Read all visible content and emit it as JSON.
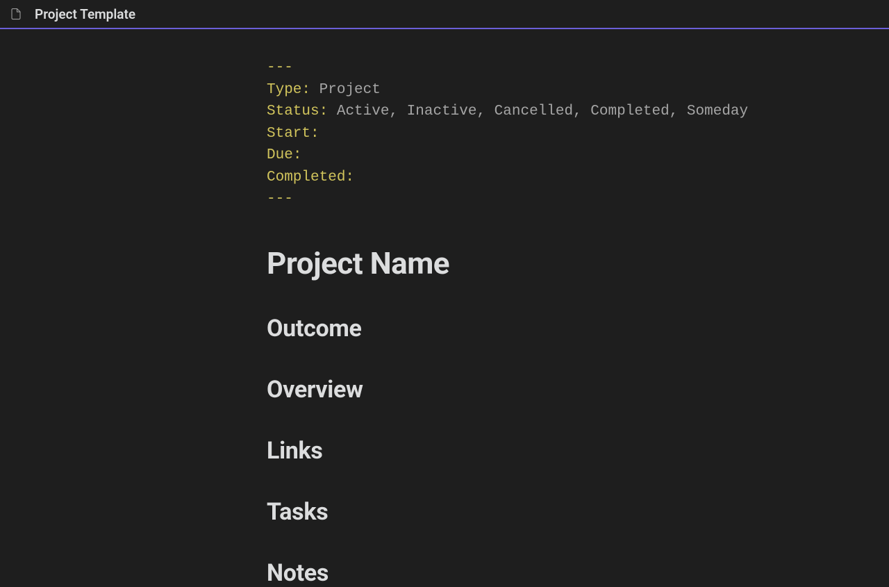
{
  "header": {
    "title": "Project Template"
  },
  "frontmatter": {
    "sep": "---",
    "type_key": "Type",
    "type_val": "Project",
    "status_key": "Status",
    "status_val": "Active, Inactive, Cancelled, Completed, Someday",
    "start_key": "Start",
    "start_val": "",
    "due_key": "Due",
    "due_val": "",
    "completed_key": "Completed",
    "completed_val": ""
  },
  "doc": {
    "h1": "Project Name",
    "h2_outcome": "Outcome",
    "h2_overview": "Overview",
    "h2_links": "Links",
    "h2_tasks": "Tasks",
    "h2_notes": "Notes"
  }
}
